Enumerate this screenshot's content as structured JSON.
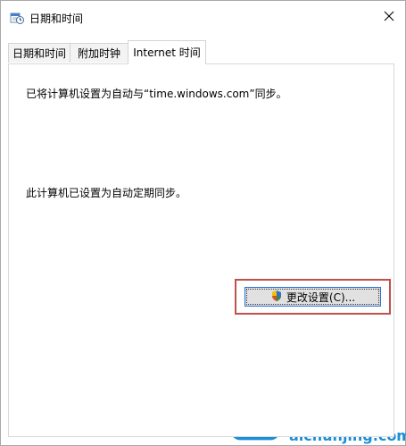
{
  "window": {
    "title": "日期和时间",
    "close_icon": "close-icon"
  },
  "tabs": [
    {
      "label": "日期和时间",
      "active": false
    },
    {
      "label": "附加时钟",
      "active": false
    },
    {
      "label": "Internet 时间",
      "active": true
    }
  ],
  "internet_time": {
    "sync_status": "已将计算机设置为自动与“time.windows.com”同步。",
    "next_sync": "此计算机已设置为自动定期同步。",
    "change_settings_label": "更改设置(C)...",
    "change_settings_icon": "uac-shield-icon"
  },
  "watermark": {
    "brand_cn": "爱纯净",
    "brand_url": "aichunjing.com",
    "brand_color": "#1a8fd6"
  },
  "colors": {
    "highlight_border": "#c0504d",
    "button_focus": "#2a6fdb"
  }
}
